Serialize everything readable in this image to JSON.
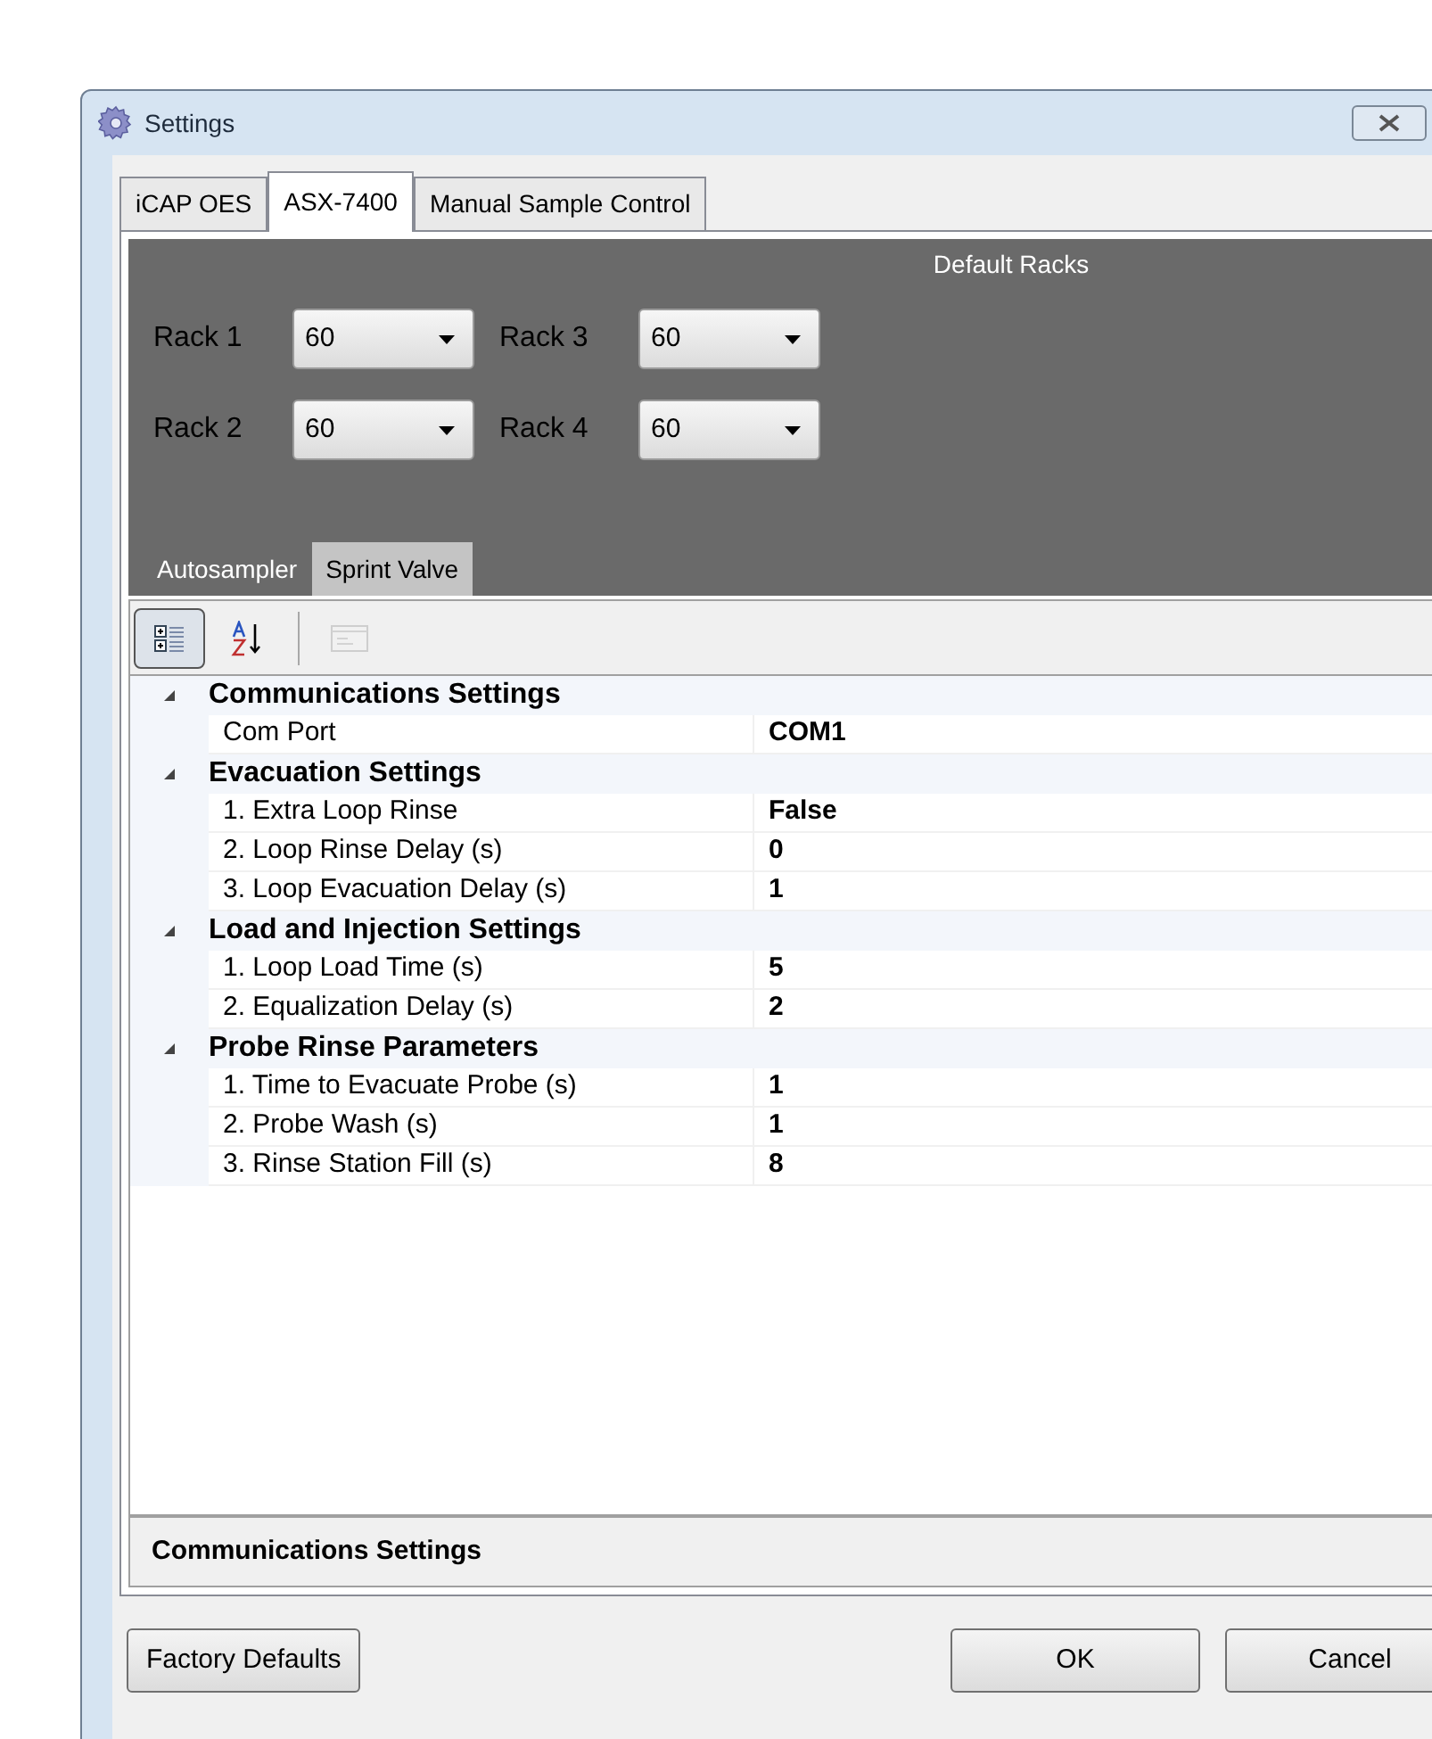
{
  "window": {
    "title": "Settings"
  },
  "tabs": [
    {
      "label": "iCAP OES",
      "selected": false
    },
    {
      "label": "ASX-7400",
      "selected": true
    },
    {
      "label": "Manual Sample Control",
      "selected": false
    }
  ],
  "default_racks": {
    "title": "Default Racks",
    "racks": [
      {
        "label": "Rack 1",
        "value": "60"
      },
      {
        "label": "Rack 3",
        "value": "60"
      },
      {
        "label": "Rack 2",
        "value": "60"
      },
      {
        "label": "Rack 4",
        "value": "60"
      }
    ]
  },
  "subtabs": [
    {
      "label": "Autosampler",
      "selected": false
    },
    {
      "label": "Sprint Valve",
      "selected": true
    }
  ],
  "toolbar": [
    {
      "kind": "categorized",
      "selected": true,
      "disabled": false
    },
    {
      "kind": "alphabetical",
      "selected": false,
      "disabled": false
    },
    {
      "kind": "separator"
    },
    {
      "kind": "property-pages",
      "selected": false,
      "disabled": true
    }
  ],
  "categories": [
    {
      "name": "Communications Settings",
      "expanded": true,
      "properties": [
        {
          "name": "Com Port",
          "value": "COM1"
        }
      ]
    },
    {
      "name": "Evacuation Settings",
      "expanded": true,
      "properties": [
        {
          "name": "1. Extra Loop Rinse",
          "value": "False"
        },
        {
          "name": "2. Loop Rinse Delay (s)",
          "value": "0"
        },
        {
          "name": "3. Loop Evacuation Delay (s)",
          "value": "1"
        }
      ]
    },
    {
      "name": "Load and Injection Settings",
      "expanded": true,
      "properties": [
        {
          "name": "1. Loop Load Time (s)",
          "value": "5"
        },
        {
          "name": "2. Equalization Delay (s)",
          "value": "2"
        }
      ]
    },
    {
      "name": "Probe Rinse Parameters",
      "expanded": true,
      "properties": [
        {
          "name": "1. Time to Evacuate Probe (s)",
          "value": "1"
        },
        {
          "name": "2. Probe Wash (s)",
          "value": "1"
        },
        {
          "name": "3. Rinse Station Fill (s)",
          "value": "8"
        }
      ]
    }
  ],
  "description": {
    "title": "Communications Settings"
  },
  "buttons": [
    {
      "label": "Factory Defaults",
      "kind": "left"
    },
    {
      "label": "OK",
      "kind": "right"
    },
    {
      "label": "Cancel",
      "kind": "right"
    }
  ]
}
